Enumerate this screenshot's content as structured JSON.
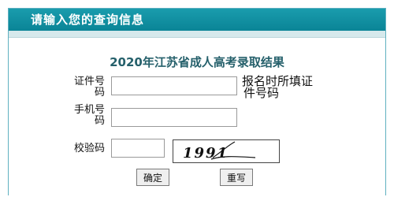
{
  "header": {
    "title": "请输入您的查询信息"
  },
  "form": {
    "title": "2020年江苏省成人高考录取结果",
    "id_label_line1": "证件号",
    "id_label_line2": "码",
    "id_value": "",
    "id_hint_line1": "报名时所填证",
    "id_hint_line2": "件号码",
    "phone_label_line1": "手机号",
    "phone_label_line2": "码",
    "phone_value": "",
    "captcha_label": "校验码",
    "captcha_value": "",
    "captcha_text": "1991"
  },
  "buttons": {
    "confirm": "确定",
    "reset": "重写"
  }
}
